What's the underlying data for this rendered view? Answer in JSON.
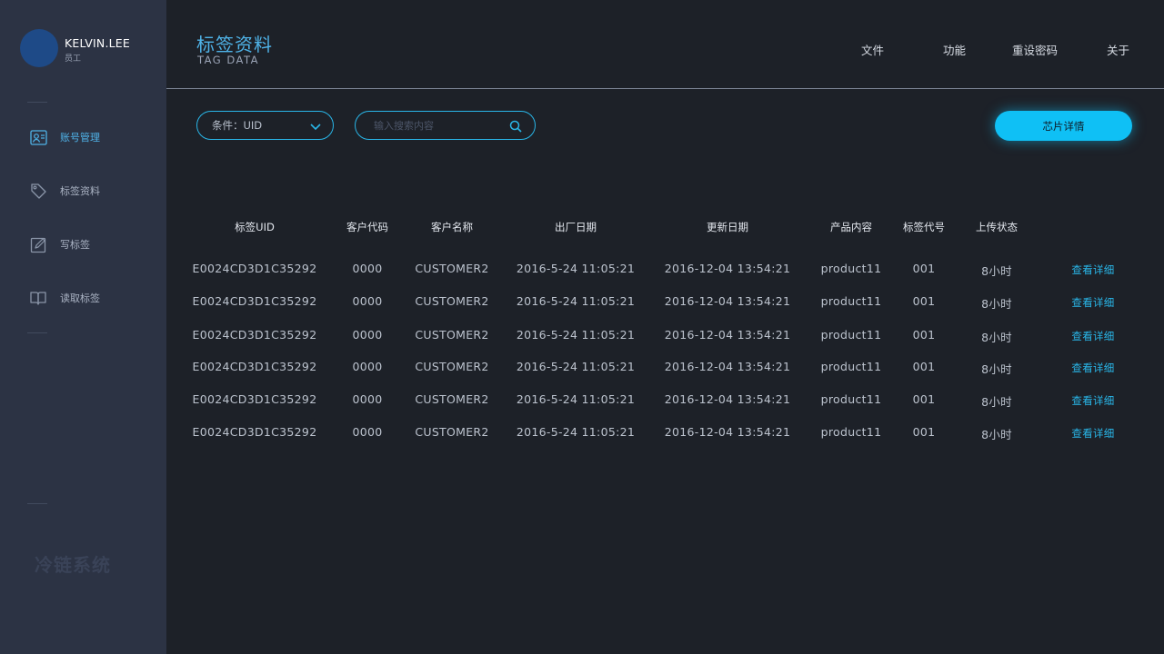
{
  "user": {
    "name": "KELVIN.LEE",
    "role": "员工"
  },
  "sidebar": {
    "items": [
      {
        "label": "账号管理",
        "icon": "id-card-icon"
      },
      {
        "label": "标签资料",
        "icon": "tag-icon"
      },
      {
        "label": "写标签",
        "icon": "edit-icon"
      },
      {
        "label": "读取标签",
        "icon": "book-icon"
      }
    ],
    "brand": "冷链系统"
  },
  "header": {
    "title": "标签资料",
    "subtitle": "TAG DATA",
    "nav": [
      "文件",
      "功能",
      "重设密码",
      "关于"
    ]
  },
  "filters": {
    "condition_label": "条件：UID",
    "search_placeholder": "输入搜索内容",
    "chip_button": "芯片详情"
  },
  "colors": {
    "accent": "#29b6e8",
    "button": "#0fc0f5",
    "sidebar": "#2c3344",
    "background": "#1d2128"
  },
  "table": {
    "headers": [
      "标签UID",
      "客户代码",
      "客户名称",
      "出厂日期",
      "更新日期",
      "产品内容",
      "标签代号",
      "上传状态"
    ],
    "rows": [
      [
        "E0024CD3D1C35292",
        "0000",
        "CUSTOMER2",
        "2016-5-24 11:05:21",
        "2016-12-04 13:54:21",
        "product11",
        "001",
        "8小时",
        "查看详细"
      ],
      [
        "E0024CD3D1C35292",
        "0000",
        "CUSTOMER2",
        "2016-5-24 11:05:21",
        "2016-12-04 13:54:21",
        "product11",
        "001",
        "8小时",
        "查看详细"
      ],
      [
        "E0024CD3D1C35292",
        "0000",
        "CUSTOMER2",
        "2016-5-24 11:05:21",
        "2016-12-04 13:54:21",
        "product11",
        "001",
        "8小时",
        "查看详细"
      ],
      [
        "E0024CD3D1C35292",
        "0000",
        "CUSTOMER2",
        "2016-5-24 11:05:21",
        "2016-12-04 13:54:21",
        "product11",
        "001",
        "8小时",
        "查看详细"
      ],
      [
        "E0024CD3D1C35292",
        "0000",
        "CUSTOMER2",
        "2016-5-24 11:05:21",
        "2016-12-04 13:54:21",
        "product11",
        "001",
        "8小时",
        "查看详细"
      ],
      [
        "E0024CD3D1C35292",
        "0000",
        "CUSTOMER2",
        "2016-5-24 11:05:21",
        "2016-12-04 13:54:21",
        "product11",
        "001",
        "8小时",
        "查看详细"
      ]
    ]
  }
}
